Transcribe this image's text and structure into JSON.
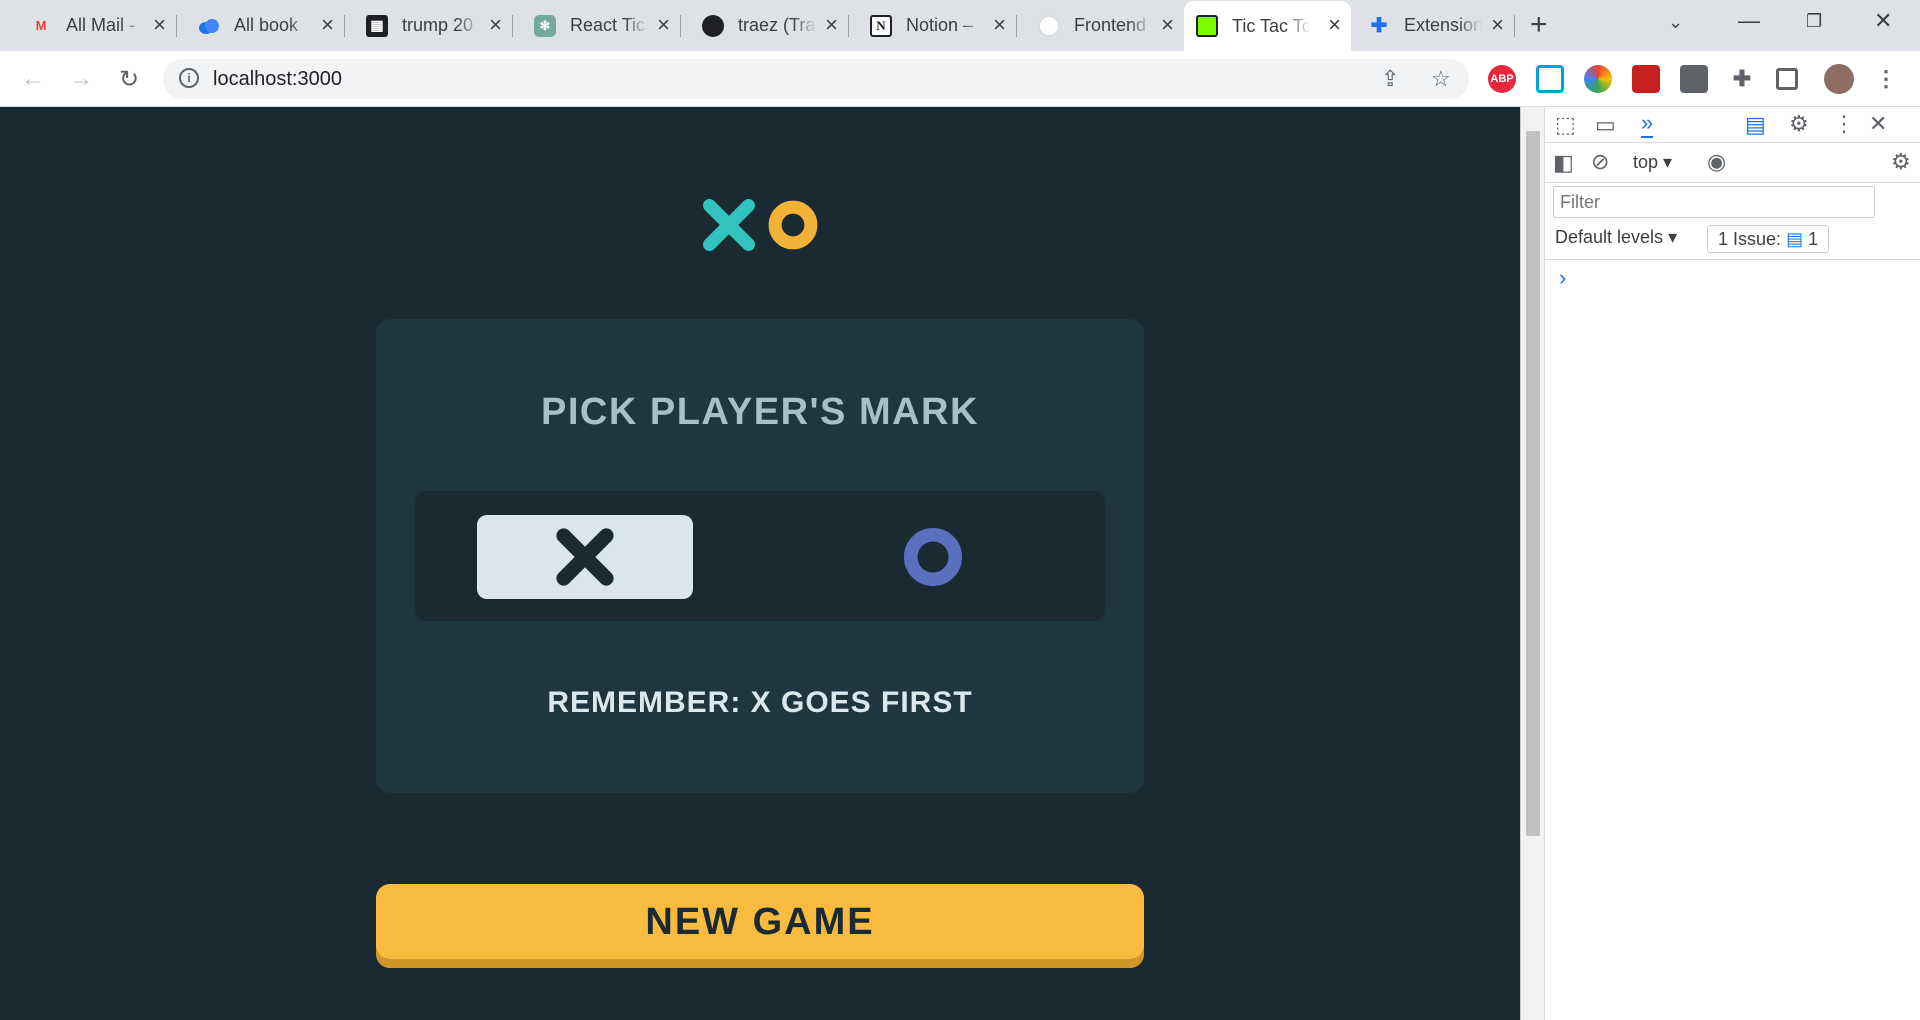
{
  "browser": {
    "tabs": [
      {
        "title": "All Mail -",
        "favicon_text": "M",
        "color": "#ea4335"
      },
      {
        "title": "All book",
        "favicon_text": "",
        "color": "#1a73e8"
      },
      {
        "title": "trump 20",
        "favicon_text": "▦",
        "color": "#202124"
      },
      {
        "title": "React Tic",
        "favicon_text": "✻",
        "color": "#74aa9c"
      },
      {
        "title": "traez (Tra",
        "favicon_text": "",
        "color": "#202124"
      },
      {
        "title": "Notion –",
        "favicon_text": "N",
        "color": "#202124"
      },
      {
        "title": "Frontend",
        "favicon_text": "",
        "color": "#9aa0a6"
      },
      {
        "title": "Tic Tac To",
        "favicon_text": "",
        "color": "#7cfc00"
      },
      {
        "title": "Extension",
        "favicon_text": "✚",
        "color": "#1a73e8"
      }
    ],
    "active_tab_index": 7,
    "url": "localhost:3000",
    "extensions": [
      "ABP"
    ]
  },
  "app": {
    "card_title": "PICK PLAYER'S MARK",
    "selected_mark": "X",
    "remember_text": "REMEMBER: X GOES FIRST",
    "new_game_label": "NEW GAME",
    "colors": {
      "background": "#1a2a33",
      "card": "#1f3641",
      "x_color": "#31c3bd",
      "o_color": "#f2b137",
      "o_option_color": "#5a6fbd",
      "button": "#f8bb3d"
    }
  },
  "devtools": {
    "context": "top",
    "filter_placeholder": "Filter",
    "levels_label": "Default levels",
    "issues_label": "1 Issue:",
    "issues_count": "1"
  }
}
